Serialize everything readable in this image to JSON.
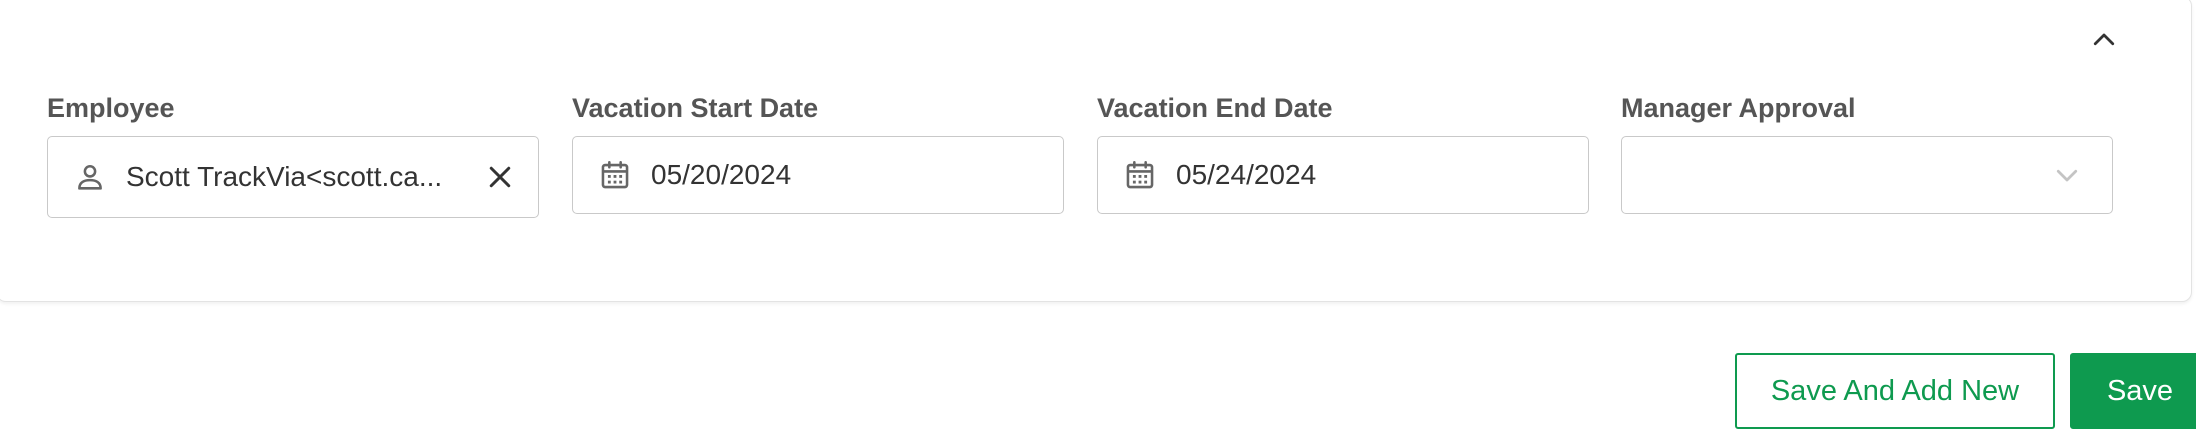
{
  "form": {
    "fields": [
      {
        "label": "Employee",
        "value": "Scott TrackVia<scott.ca...",
        "lead_icon": "person-icon",
        "clear_icon": "close-icon"
      },
      {
        "label": "Vacation Start Date",
        "value": "05/20/2024",
        "lead_icon": "calendar-icon"
      },
      {
        "label": "Vacation End Date",
        "value": "05/24/2024",
        "lead_icon": "calendar-icon"
      },
      {
        "label": "Manager Approval",
        "value": "",
        "trail_icon": "chevron-down-icon"
      }
    ],
    "collapse_icon": "chevron-up-icon"
  },
  "actions": {
    "save_and_add_new_label": "Save And Add New",
    "save_label": "Save"
  },
  "colors": {
    "accent": "#0e9a4f",
    "border": "#c9c9c9",
    "label": "#555555",
    "text": "#333333"
  }
}
